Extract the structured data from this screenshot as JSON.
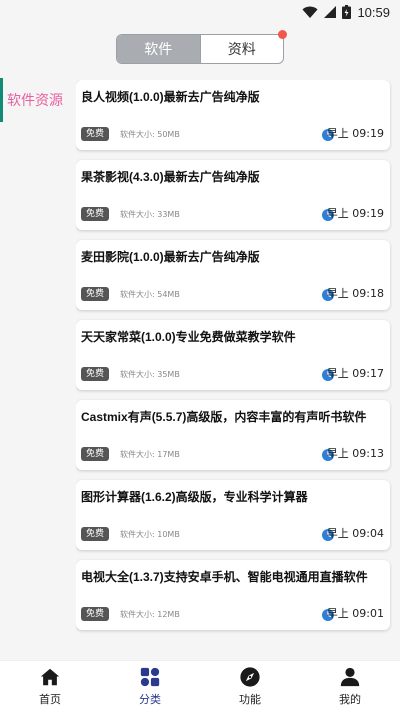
{
  "status": {
    "time": "10:59"
  },
  "segment": {
    "tabs": [
      "软件",
      "资料"
    ]
  },
  "sidebar": {
    "items": [
      "软件资源"
    ]
  },
  "labels": {
    "size_prefix": "软件大小:"
  },
  "items": [
    {
      "title": "良人视频(1.0.0)最新去广告纯净版",
      "badge": "免费",
      "size": "50MB",
      "time": "早上 09:19"
    },
    {
      "title": "果茶影视(4.3.0)最新去广告纯净版",
      "badge": "免费",
      "size": "33MB",
      "time": "早上 09:19"
    },
    {
      "title": "麦田影院(1.0.0)最新去广告纯净版",
      "badge": "免费",
      "size": "54MB",
      "time": "早上 09:18"
    },
    {
      "title": "天天家常菜(1.0.0)专业免费做菜教学软件",
      "badge": "免费",
      "size": "35MB",
      "time": "早上 09:17"
    },
    {
      "title": "Castmix有声(5.5.7)高级版，内容丰富的有声听书软件",
      "badge": "免费",
      "size": "17MB",
      "time": "早上 09:13"
    },
    {
      "title": "图形计算器(1.6.2)高级版，专业科学计算器",
      "badge": "免费",
      "size": "10MB",
      "time": "早上 09:04"
    },
    {
      "title": "电视大全(1.3.7)支持安卓手机、智能电视通用直播软件",
      "badge": "免费",
      "size": "12MB",
      "time": "早上 09:01"
    }
  ],
  "bottom_nav": [
    {
      "label": "首页",
      "icon": "home-icon"
    },
    {
      "label": "分类",
      "icon": "category-icon"
    },
    {
      "label": "功能",
      "icon": "compass-icon"
    },
    {
      "label": "我的",
      "icon": "user-icon"
    }
  ],
  "colors": {
    "accent": "#2a3a8f",
    "sidebar_text": "#e95ea0",
    "sidebar_bar": "#138a74",
    "clock": "#2f7fd6",
    "red_dot": "#f1574a"
  }
}
